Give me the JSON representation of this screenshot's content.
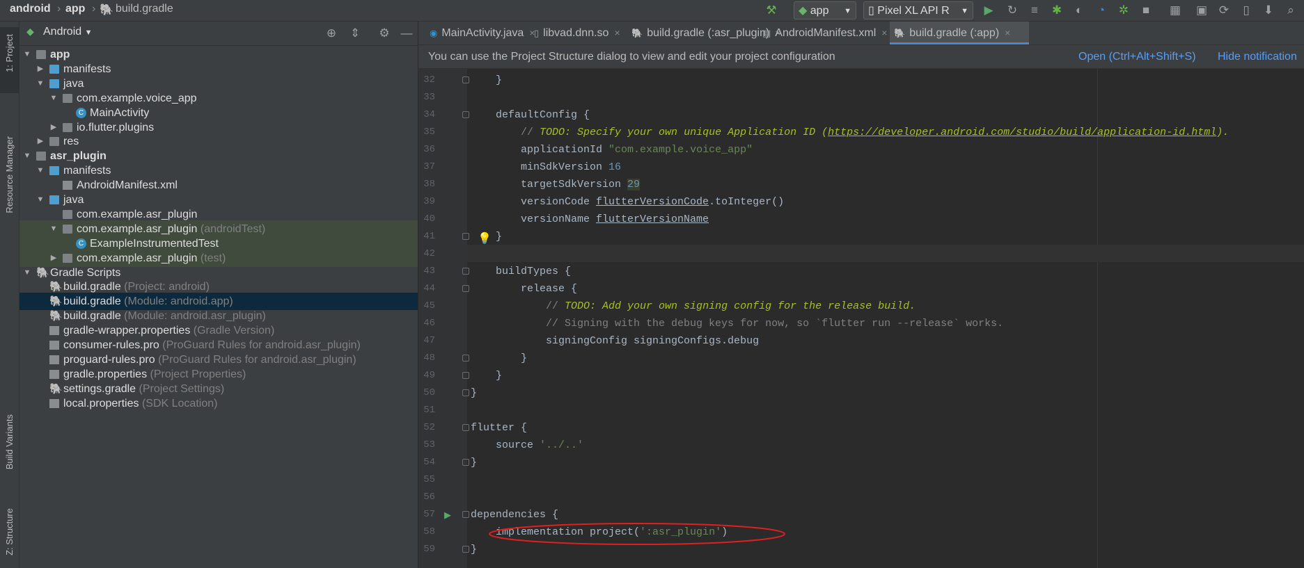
{
  "breadcrumb": {
    "items": [
      "android",
      "app",
      "build.gradle"
    ]
  },
  "toolbar": {
    "run_config": "app",
    "device": "Pixel XL API R"
  },
  "left_strip": {
    "project": "1: Project",
    "resource_manager": "Resource Manager",
    "build_variants": "Build Variants",
    "structure": "Z: Structure"
  },
  "project_panel": {
    "view_selector": "Android",
    "tree": [
      {
        "label": "app",
        "sub": "",
        "depth": 0,
        "arrow": "▼",
        "icon": "module"
      },
      {
        "label": "manifests",
        "sub": "",
        "depth": 1,
        "arrow": "▶",
        "icon": "folder"
      },
      {
        "label": "java",
        "sub": "",
        "depth": 1,
        "arrow": "▼",
        "icon": "folder"
      },
      {
        "label": "com.example.voice_app",
        "sub": "",
        "depth": 2,
        "arrow": "▼",
        "icon": "package"
      },
      {
        "label": "MainActivity",
        "sub": "",
        "depth": 3,
        "arrow": "",
        "icon": "class"
      },
      {
        "label": "io.flutter.plugins",
        "sub": "",
        "depth": 2,
        "arrow": "▶",
        "icon": "package"
      },
      {
        "label": "res",
        "sub": "",
        "depth": 1,
        "arrow": "▶",
        "icon": "res"
      },
      {
        "label": "asr_plugin",
        "sub": "",
        "depth": 0,
        "arrow": "▼",
        "icon": "module"
      },
      {
        "label": "manifests",
        "sub": "",
        "depth": 1,
        "arrow": "▼",
        "icon": "folder"
      },
      {
        "label": "AndroidManifest.xml",
        "sub": "",
        "depth": 2,
        "arrow": "",
        "icon": "manifest"
      },
      {
        "label": "java",
        "sub": "",
        "depth": 1,
        "arrow": "▼",
        "icon": "folder"
      },
      {
        "label": "com.example.asr_plugin",
        "sub": "",
        "depth": 2,
        "arrow": "",
        "icon": "package"
      },
      {
        "label": "com.example.asr_plugin",
        "sub": "(androidTest)",
        "depth": 2,
        "arrow": "▼",
        "icon": "package"
      },
      {
        "label": "ExampleInstrumentedTest",
        "sub": "",
        "depth": 3,
        "arrow": "",
        "icon": "class"
      },
      {
        "label": "com.example.asr_plugin",
        "sub": "(test)",
        "depth": 2,
        "arrow": "▶",
        "icon": "package"
      },
      {
        "label": "Gradle Scripts",
        "sub": "",
        "depth": 0,
        "arrow": "▼",
        "icon": "gradle"
      },
      {
        "label": "build.gradle",
        "sub": "(Project: android)",
        "depth": 1,
        "arrow": "",
        "icon": "gradle"
      },
      {
        "label": "build.gradle",
        "sub": "(Module: android.app)",
        "depth": 1,
        "arrow": "",
        "icon": "gradle"
      },
      {
        "label": "build.gradle",
        "sub": "(Module: android.asr_plugin)",
        "depth": 1,
        "arrow": "",
        "icon": "gradle"
      },
      {
        "label": "gradle-wrapper.properties",
        "sub": "(Gradle Version)",
        "depth": 1,
        "arrow": "",
        "icon": "props"
      },
      {
        "label": "consumer-rules.pro",
        "sub": "(ProGuard Rules for android.asr_plugin)",
        "depth": 1,
        "arrow": "",
        "icon": "file"
      },
      {
        "label": "proguard-rules.pro",
        "sub": "(ProGuard Rules for android.asr_plugin)",
        "depth": 1,
        "arrow": "",
        "icon": "file"
      },
      {
        "label": "gradle.properties",
        "sub": "(Project Properties)",
        "depth": 1,
        "arrow": "",
        "icon": "props"
      },
      {
        "label": "settings.gradle",
        "sub": "(Project Settings)",
        "depth": 1,
        "arrow": "",
        "icon": "gradle"
      },
      {
        "label": "local.properties",
        "sub": "(SDK Location)",
        "depth": 1,
        "arrow": "",
        "icon": "props"
      }
    ]
  },
  "tabs": [
    {
      "label": "MainActivity.java",
      "icon": "class"
    },
    {
      "label": "libvad.dnn.so",
      "icon": "file"
    },
    {
      "label": "build.gradle (:asr_plugin)",
      "icon": "gradle"
    },
    {
      "label": "AndroidManifest.xml",
      "icon": "manifest"
    },
    {
      "label": "build.gradle (:app)",
      "icon": "gradle"
    }
  ],
  "tab_close": "×",
  "notification": {
    "message": "You can use the Project Structure dialog to view and edit your project configuration",
    "open_link": "Open (Ctrl+Alt+Shift+S)",
    "hide_link": "Hide notification"
  },
  "code": {
    "line_numbers": [
      "32",
      "33",
      "34",
      "35",
      "36",
      "37",
      "38",
      "39",
      "40",
      "41",
      "42",
      "43",
      "44",
      "45",
      "46",
      "47",
      "48",
      "49",
      "50",
      "51",
      "52",
      "53",
      "54",
      "55",
      "56",
      "57",
      "58",
      "59"
    ],
    "lines": {
      "l32": "    }",
      "l34": "    defaultConfig {",
      "l35_pre": "        // ",
      "l35_todo": "TODO: Specify your own unique Application ID (",
      "l35_url": "https://developer.android.com/studio/build/application-id.html",
      "l35_post": ").",
      "l36_kw": "        applicationId ",
      "l36_str": "\"com.example.voice_app\"",
      "l37_kw": "        minSdkVersion ",
      "l37_num": "16",
      "l38_kw": "        targetSdkVersion ",
      "l38_num": "29",
      "l39_kw": "        versionCode ",
      "l39_var": "flutterVersionCode",
      "l39_post": ".toInteger()",
      "l40_kw": "        versionName ",
      "l40_var": "flutterVersionName",
      "l41": "    }",
      "l43": "    buildTypes {",
      "l44": "        release {",
      "l45_pre": "            // ",
      "l45_todo": "TODO: Add your own signing config for the release build.",
      "l46": "            // Signing with the debug keys for now, so `flutter run --release` works.",
      "l47": "            signingConfig signingConfigs.debug",
      "l48": "        }",
      "l49": "    }",
      "l50": "}",
      "l52": "flutter {",
      "l53_kw": "    source ",
      "l53_str": "'../..'",
      "l54": "}",
      "l57": "dependencies {",
      "l58_kw": "    implementation project(",
      "l58_str": "':asr_plugin'",
      "l58_post": ")",
      "l59": "}"
    }
  },
  "colors": {
    "selection": "#0d293e",
    "highlight": "#404b3d",
    "annotation_oval": "#e02020",
    "link": "#589df6"
  }
}
